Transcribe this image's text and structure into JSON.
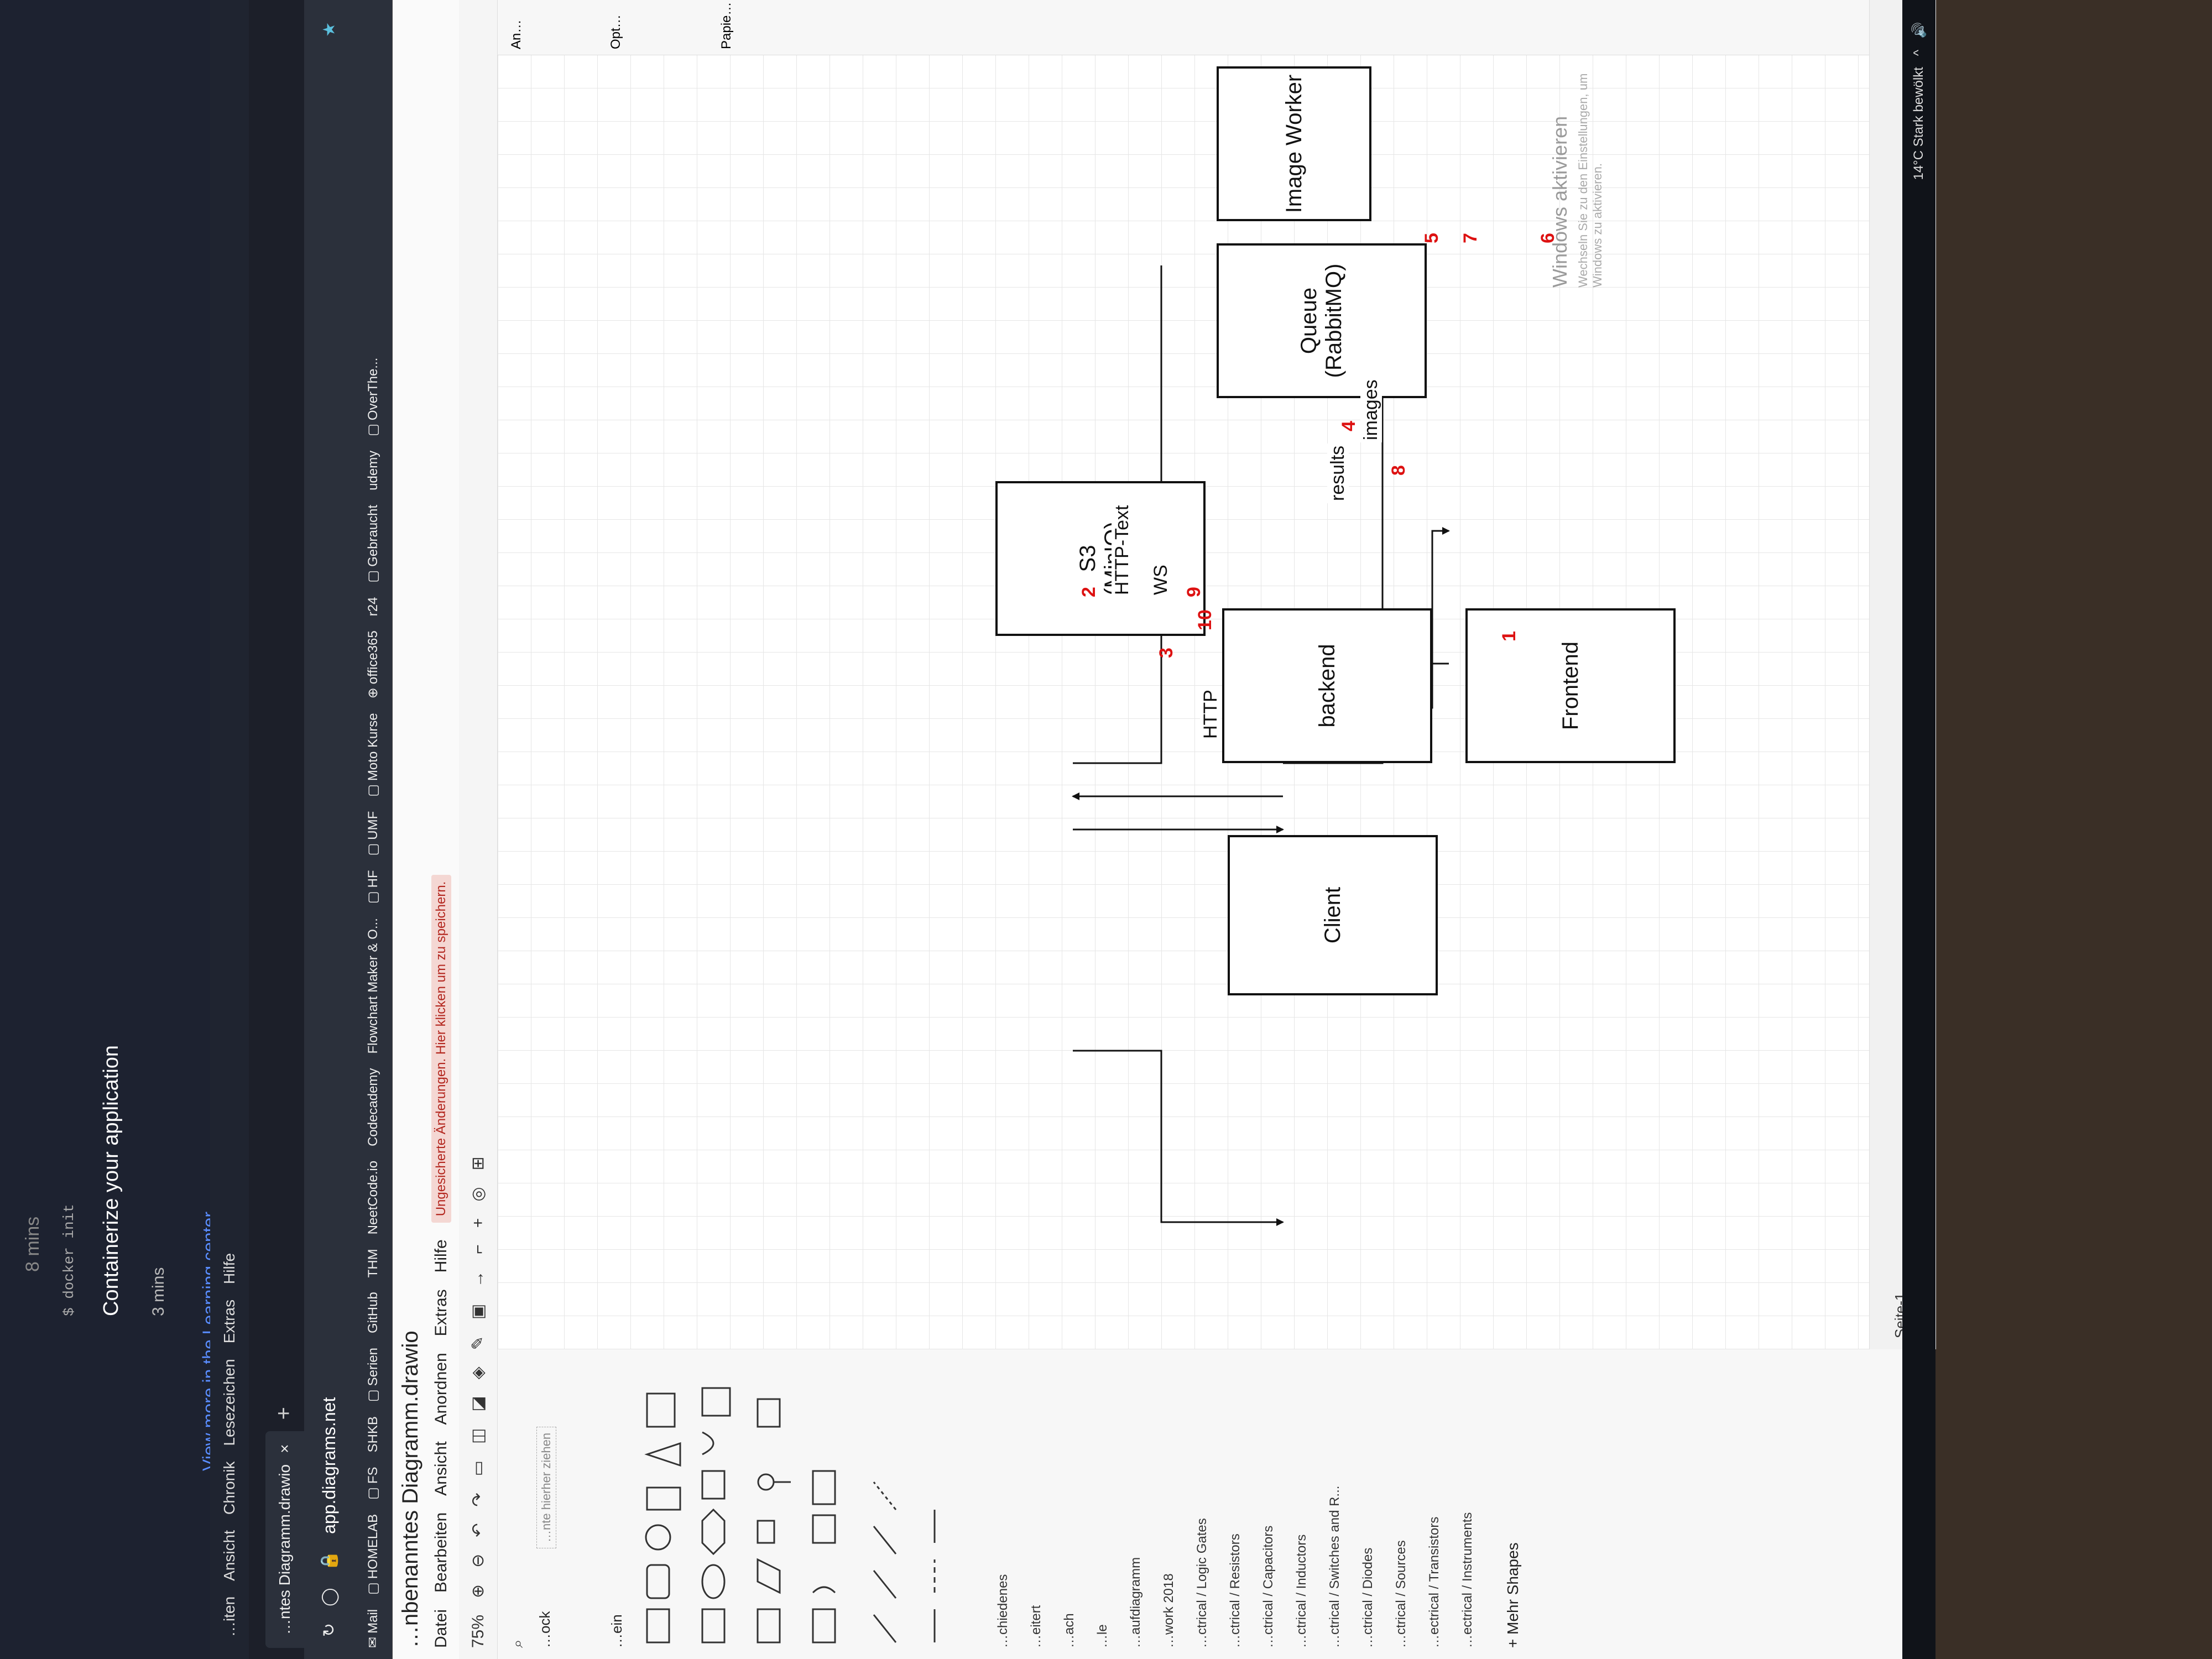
{
  "left_monitor": {
    "time_top": "8 mins",
    "card_title": "Containerize your application",
    "card_code": "$ docker init",
    "card_time": "3 mins",
    "learning_link": "View more in the Learning center"
  },
  "browser": {
    "menu": [
      "…iten",
      "Ansicht",
      "Chronik",
      "Lesezeichen",
      "Extras",
      "Hilfe"
    ],
    "tab_title": "…ntes Diagramm.drawio",
    "tab_close": "×",
    "new_tab": "+",
    "url": "app.diagrams.net",
    "bookmarks": [
      "Mail",
      "HOMELAB",
      "FS",
      "SHKB",
      "Serien",
      "GitHub",
      "THM",
      "NeetCode.io",
      "Codecademy",
      "Flowchart Maker & O...",
      "HF",
      "UMF",
      "Moto Kurse",
      "office365",
      "r24",
      "Gebraucht",
      "udemy",
      "OverThe..."
    ]
  },
  "app": {
    "title": "…nbenanntes Diagramm.drawio",
    "menu": [
      "Datei",
      "Bearbeiten",
      "Ansicht",
      "Anordnen",
      "Extras",
      "Hilfe"
    ],
    "unsaved_notice": "Ungesicherte Änderungen. Hier klicken um zu speichern.",
    "zoom": "75%",
    "sidebar": {
      "search_hint": "…nte hierher ziehen",
      "sections_top": [
        "…ock",
        "…ein"
      ],
      "libraries": [
        "…chiedenes",
        "…eitert",
        "…ach",
        "…le",
        "…aufdiagramm",
        "…work 2018",
        "…ctrical / Logic Gates",
        "…ctrical / Resistors",
        "…ctrical / Capacitors",
        "…ctrical / Inductors",
        "…ctrical / Switches and R...",
        "…ctrical / Diodes",
        "…ctrical / Sources",
        "…ectrical / Transistors",
        "…ectrical / Instruments"
      ],
      "more_shapes": "+ Mehr Shapes"
    },
    "page_tab": "Seite-1",
    "right_panel": [
      "An…",
      "Opt…",
      "Papie…"
    ]
  },
  "diagram": {
    "nodes": {
      "frontend": "Frontend",
      "backend": "backend",
      "client": "Client",
      "s3": "S3\n(MinIO)",
      "queue": "Queue\n(RabbitMQ)",
      "worker": "Image Worker"
    },
    "edge_labels": {
      "http_text": "HTTP-Text",
      "ws": "WS",
      "http": "HTTP",
      "results": "results",
      "images": "images"
    },
    "step_numbers": [
      "1",
      "2",
      "3",
      "4",
      "5",
      "6",
      "7",
      "8",
      "9",
      "10"
    ]
  },
  "os": {
    "watermark_title": "Windows aktivieren",
    "watermark_sub": "Wechseln Sie zu den Einstellungen, um Windows zu aktivieren.",
    "weather": "14°C  Stark bewölkt"
  },
  "colors": {
    "step_number": "#dd1111",
    "unsaved_bg": "#f4d7d3",
    "link": "#5a8dff"
  }
}
